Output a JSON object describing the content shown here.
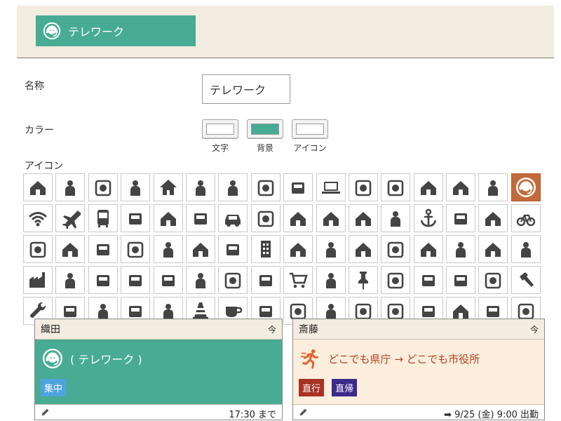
{
  "preview": {
    "label": "テレワーク"
  },
  "form": {
    "name_label": "名称",
    "name_value": "テレワーク",
    "color_label": "カラー",
    "color_buttons": [
      {
        "caption": "文字",
        "color": "#ffffff"
      },
      {
        "caption": "背景",
        "color": "#48ab93"
      },
      {
        "caption": "アイコン",
        "color": "#ffffff"
      }
    ],
    "icon_label": "アイコン"
  },
  "icon_grid": {
    "selected": "telework-headset-icon",
    "selected_color": "#c46a3a",
    "icons": [
      "person-at-desk-icon",
      "laptop-on-desk-icon",
      "meeting-people-icon",
      "running-person-icon",
      "house-icon",
      "beach-umbrella-icon",
      "office-desk-icon",
      "armchair-icon",
      "person-seated-icon",
      "laptop-icon",
      "entrance-door-icon",
      "exit-door-icon",
      "home-outline-icon",
      "shop-icon",
      "person-on-sofa-icon",
      "telework-headset-icon",
      "wifi-icon",
      "airplane-icon",
      "bus-icon",
      "truck-icon",
      "van-icon",
      "delivery-truck-icon",
      "car-icon",
      "train-icon",
      "commuter-train-icon",
      "bullet-train-icon",
      "taxi-icon",
      "ship-icon",
      "anchor-icon",
      "scooter-icon",
      "scooter-rider-icon",
      "bicycle-icon",
      "gas-station-icon",
      "postbox-icon",
      "tire-icon",
      "wheelchair-assist-icon",
      "person-with-cane-icon",
      "suitcase-icon",
      "briefcase-icon",
      "building-icon",
      "city-buildings-icon",
      "storefront-icon",
      "open-shop-icon",
      "warehouse-icon",
      "24-hours-icon",
      "dome-icon",
      "hospital-icon",
      "clinic-icon",
      "factory-icon",
      "post-office-icon",
      "server-rack-icon",
      "cpu-chip-icon",
      "radio-tower-icon",
      "bank-icon",
      "park-tree-icon",
      "camera-icon",
      "shopping-cart-icon",
      "shopping-basket-icon",
      "push-pin-icon",
      "robot-arm-icon",
      "conveyor-icon",
      "pallet-boxes-icon",
      "power-drill-icon",
      "hammer-icon",
      "wrench-icon",
      "hard-hat-worker-icon",
      "shovel-icon",
      "rake-icon",
      "graduation-cap-icon",
      "traffic-cone-icon",
      "coffee-cup-icon",
      "robot-icon",
      "hot-spring-icon",
      "drink-cup-icon",
      "cutlery-icon",
      "beer-mug-icon",
      "ramen-bowl-icon",
      "money-icon",
      "books-icon",
      "teacher-icon"
    ]
  },
  "cards": [
    {
      "name": "織田",
      "now": "今",
      "status": "( テレワーク )",
      "bg": "#48ab93",
      "tags": [
        {
          "text": "集中",
          "color": "#4ea4e0"
        }
      ],
      "footer_right": "17:30 まで"
    },
    {
      "name": "斎藤",
      "now": "今",
      "status": "どこでも県庁 → どこでも市役所",
      "bg": "#fbeedd",
      "status_color": "#b4411f",
      "tags": [
        {
          "text": "直行",
          "color": "#a83224"
        },
        {
          "text": "直帰",
          "color": "#3c2a8c"
        }
      ],
      "footer_right": "➡ 9/25 (金) 9:00 出勤"
    }
  ]
}
